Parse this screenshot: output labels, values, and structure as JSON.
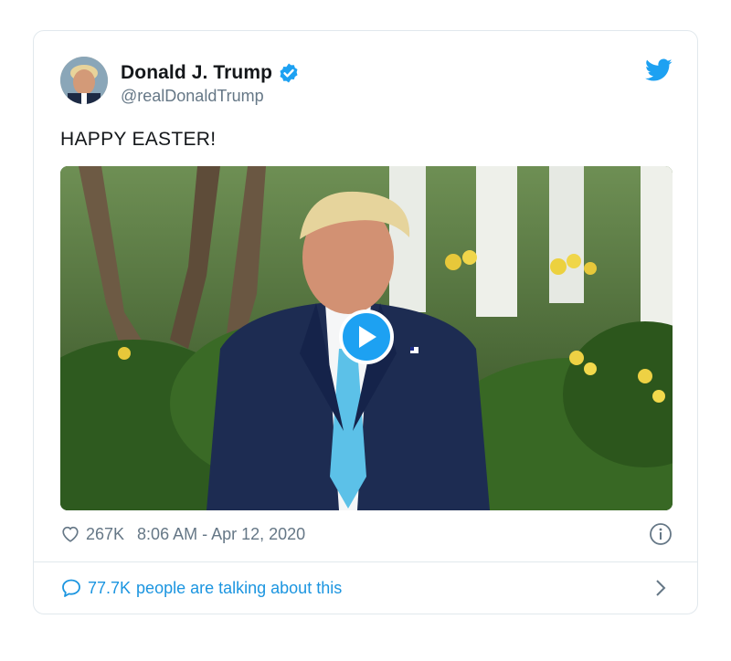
{
  "tweet": {
    "display_name": "Donald J. Trump",
    "handle": "@realDonaldTrump",
    "text": "HAPPY EASTER!",
    "like_count": "267K",
    "timestamp": "8:06 AM - Apr 12, 2020",
    "talking_count": "77.7K",
    "talking_label": "people are talking about this"
  },
  "icons": {
    "verified": "verified-badge-icon",
    "brand": "twitter-bird-icon",
    "like": "heart-icon",
    "info": "info-icon",
    "comment": "comment-bubble-icon",
    "chevron": "chevron-right-icon",
    "play": "play-icon"
  },
  "colors": {
    "brand_blue": "#1da1f2",
    "link_blue": "#1b95e0",
    "muted_gray": "#657786",
    "text": "#14171a",
    "border": "#e1e8ed"
  }
}
